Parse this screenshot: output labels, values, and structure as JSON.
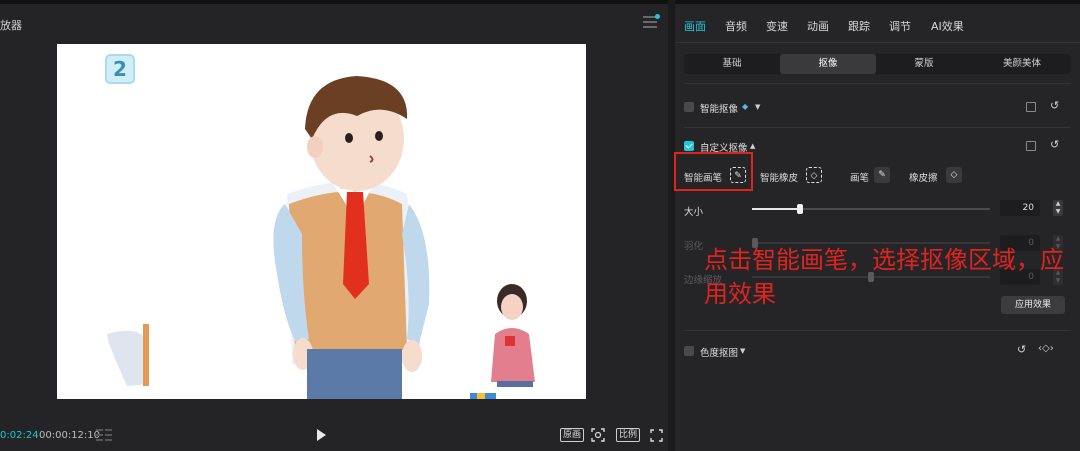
{
  "player": {
    "title": "放器",
    "time_current": "0:02:24",
    "time_total": "00:00:12:10",
    "canvas_badge": "2",
    "buttons": {
      "original": "原画",
      "ratio": "比例"
    }
  },
  "panel": {
    "tabs": [
      {
        "label": "画面",
        "active": true
      },
      {
        "label": "音频",
        "active": false
      },
      {
        "label": "变速",
        "active": false
      },
      {
        "label": "动画",
        "active": false
      },
      {
        "label": "跟踪",
        "active": false
      },
      {
        "label": "调节",
        "active": false
      },
      {
        "label": "AI效果",
        "active": false
      }
    ],
    "subtabs": [
      {
        "label": "基础",
        "active": false
      },
      {
        "label": "抠像",
        "active": true
      },
      {
        "label": "蒙版",
        "active": false
      },
      {
        "label": "美颜美体",
        "active": false
      }
    ],
    "smart_matting": {
      "label": "智能抠像",
      "checked": false
    },
    "custom_matting": {
      "label": "自定义抠像",
      "checked": true,
      "tools": {
        "smart_brush": "智能画笔",
        "smart_eraser": "智能橡皮",
        "brush": "画笔",
        "eraser": "橡皮擦"
      },
      "size_label": "大小",
      "size_value": "20",
      "size_fraction": 0.2,
      "feather_label": "羽化",
      "feather_value": "0",
      "edge_label": "边缘缩放",
      "edge_value": "0",
      "apply_label": "应用效果"
    },
    "chroma_key": {
      "label": "色度抠图",
      "checked": false
    }
  },
  "annotation": "点击智能画笔，选择抠像区域，应用效果",
  "colors": {
    "accent": "#20c7d8",
    "annotation_red": "#e0231f",
    "panel_bg": "#252527"
  }
}
